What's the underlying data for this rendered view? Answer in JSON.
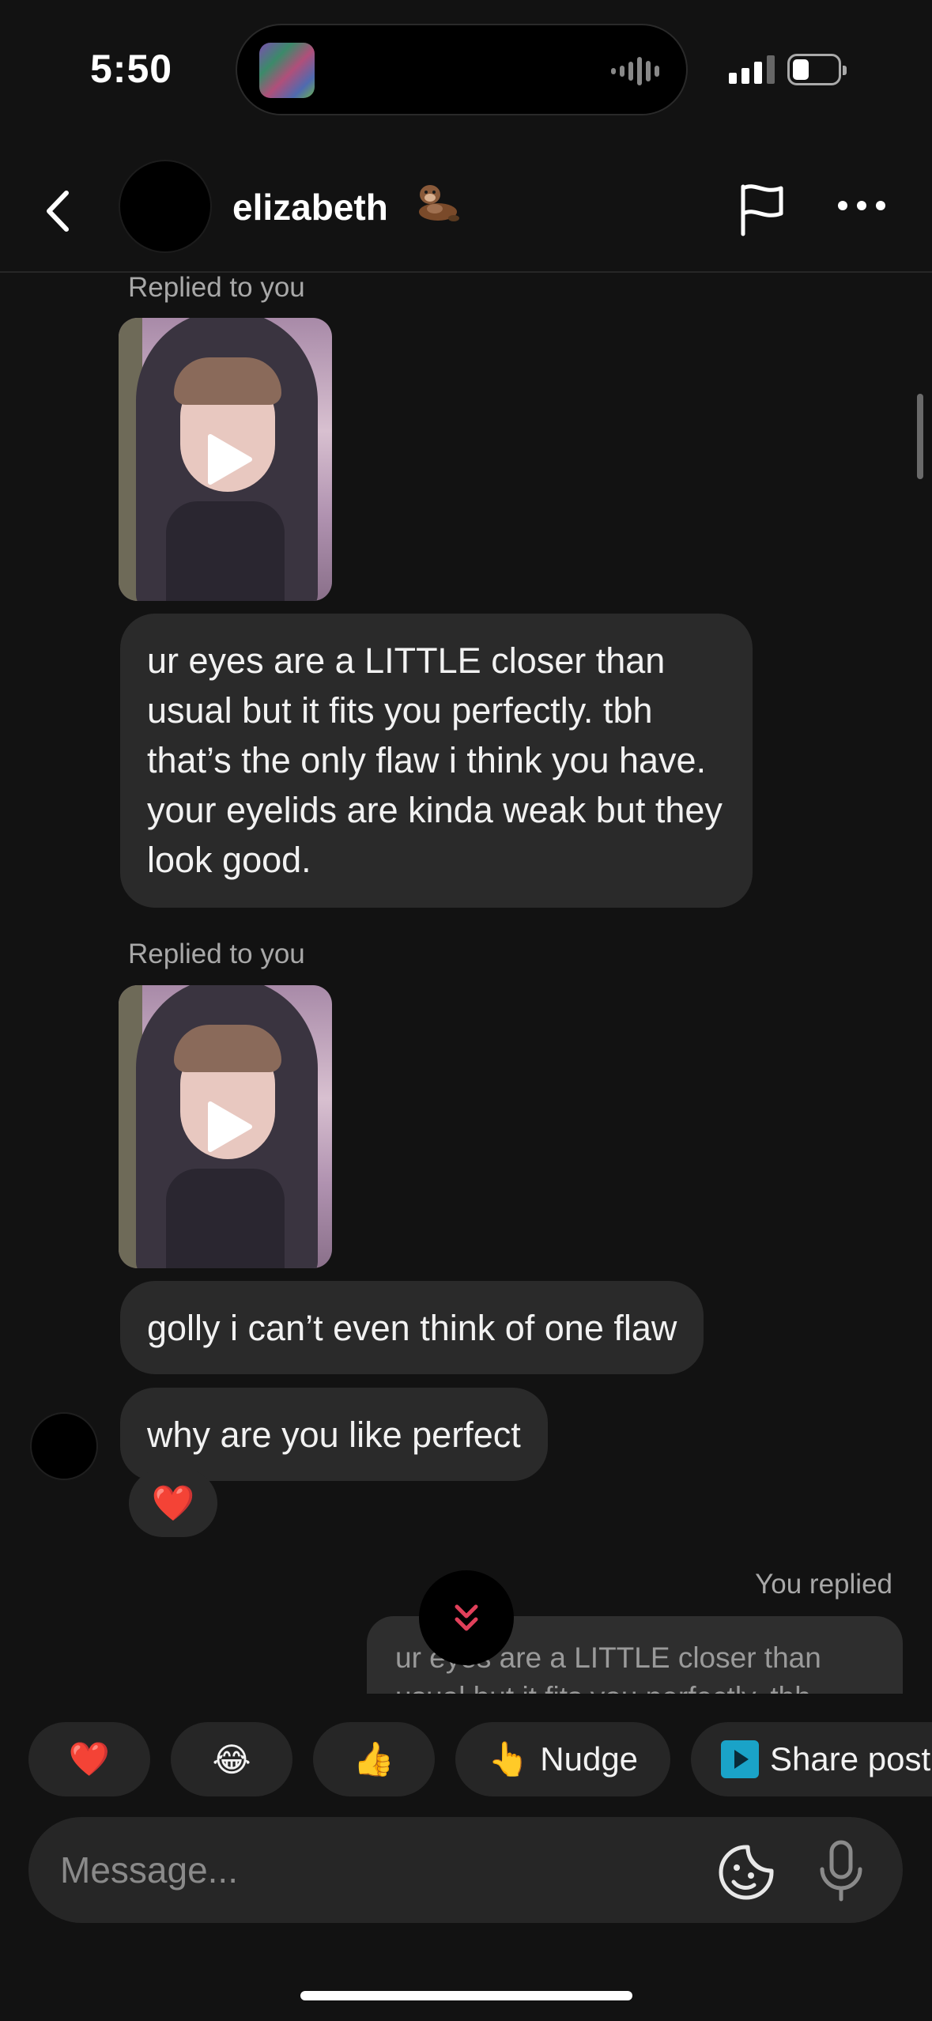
{
  "status_bar": {
    "time": "5:50"
  },
  "header": {
    "contact_name": "elizabeth",
    "name_emoji": "otter-emoji"
  },
  "messages": {
    "reply_label_1": "Replied to you",
    "bubble_1": "ur eyes are a LITTLE closer than usual but it fits you perfectly. tbh that’s the only flaw i think you have. your eyelids are kinda weak but they look good.",
    "reply_label_2": "Replied to you",
    "bubble_2": "golly i can’t even think of one flaw",
    "bubble_3": "why are you like perfect",
    "reaction": "❤️",
    "you_replied_label": "You replied",
    "quoted_text": "ur eyes are a LITTLE closer than usual but it fits you perfectly. tbh"
  },
  "quick_reactions": {
    "heart": "❤️",
    "laugh": "😂",
    "thumbs": "👍",
    "nudge_emoji": "👆",
    "nudge_label": "Nudge",
    "share_label": "Share post"
  },
  "composer": {
    "placeholder": "Message..."
  },
  "colors": {
    "background": "#121212",
    "bubble": "#2a2a2a",
    "accent_scroll": "#e0405a"
  }
}
